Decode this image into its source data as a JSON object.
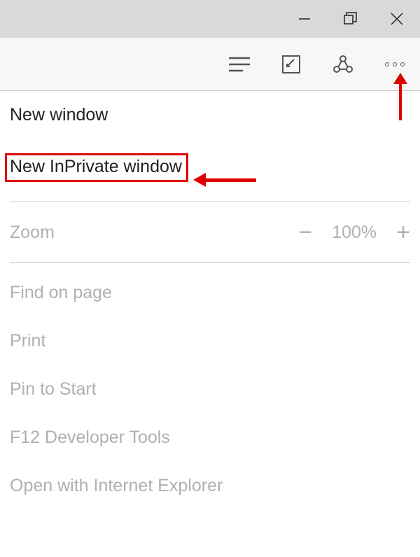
{
  "titlebar": {
    "minimize_icon": "minimize",
    "maximize_icon": "maximize",
    "close_icon": "close"
  },
  "toolbar": {
    "reading_icon": "reading-list",
    "note_icon": "web-note",
    "share_icon": "share",
    "more_icon": "more"
  },
  "menu": {
    "new_window": "New window",
    "new_inprivate": "New InPrivate window",
    "zoom_label": "Zoom",
    "zoom_value": "100%",
    "find_on_page": "Find on page",
    "print": "Print",
    "pin_to_start": "Pin to Start",
    "dev_tools": "F12 Developer Tools",
    "open_ie": "Open with Internet Explorer"
  }
}
